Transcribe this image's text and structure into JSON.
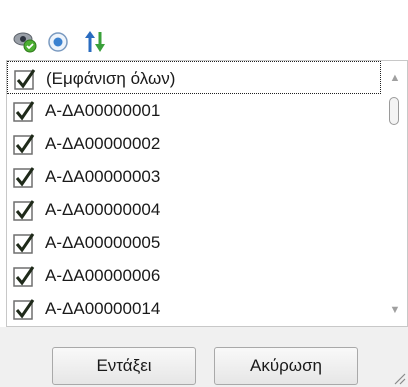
{
  "toolbar": {
    "icons": [
      "show-all-icon",
      "radio-target-icon",
      "sort-arrows-icon"
    ]
  },
  "list": {
    "items": [
      {
        "label": "(Εμφάνιση όλων)",
        "checked": true
      },
      {
        "label": "Α-ΔΑ00000001",
        "checked": true
      },
      {
        "label": "Α-ΔΑ00000002",
        "checked": true
      },
      {
        "label": "Α-ΔΑ00000003",
        "checked": true
      },
      {
        "label": "Α-ΔΑ00000004",
        "checked": true
      },
      {
        "label": "Α-ΔΑ00000005",
        "checked": true
      },
      {
        "label": "Α-ΔΑ00000006",
        "checked": true
      },
      {
        "label": "Α-ΔΑ00000014",
        "checked": true
      }
    ],
    "scroll_up_glyph": "▲",
    "scroll_down_glyph": "▼"
  },
  "footer": {
    "ok_label": "Εντάξει",
    "cancel_label": "Ακύρωση"
  },
  "colors": {
    "check_green": "#3a7d2a",
    "check_border": "#6f6f6f"
  }
}
